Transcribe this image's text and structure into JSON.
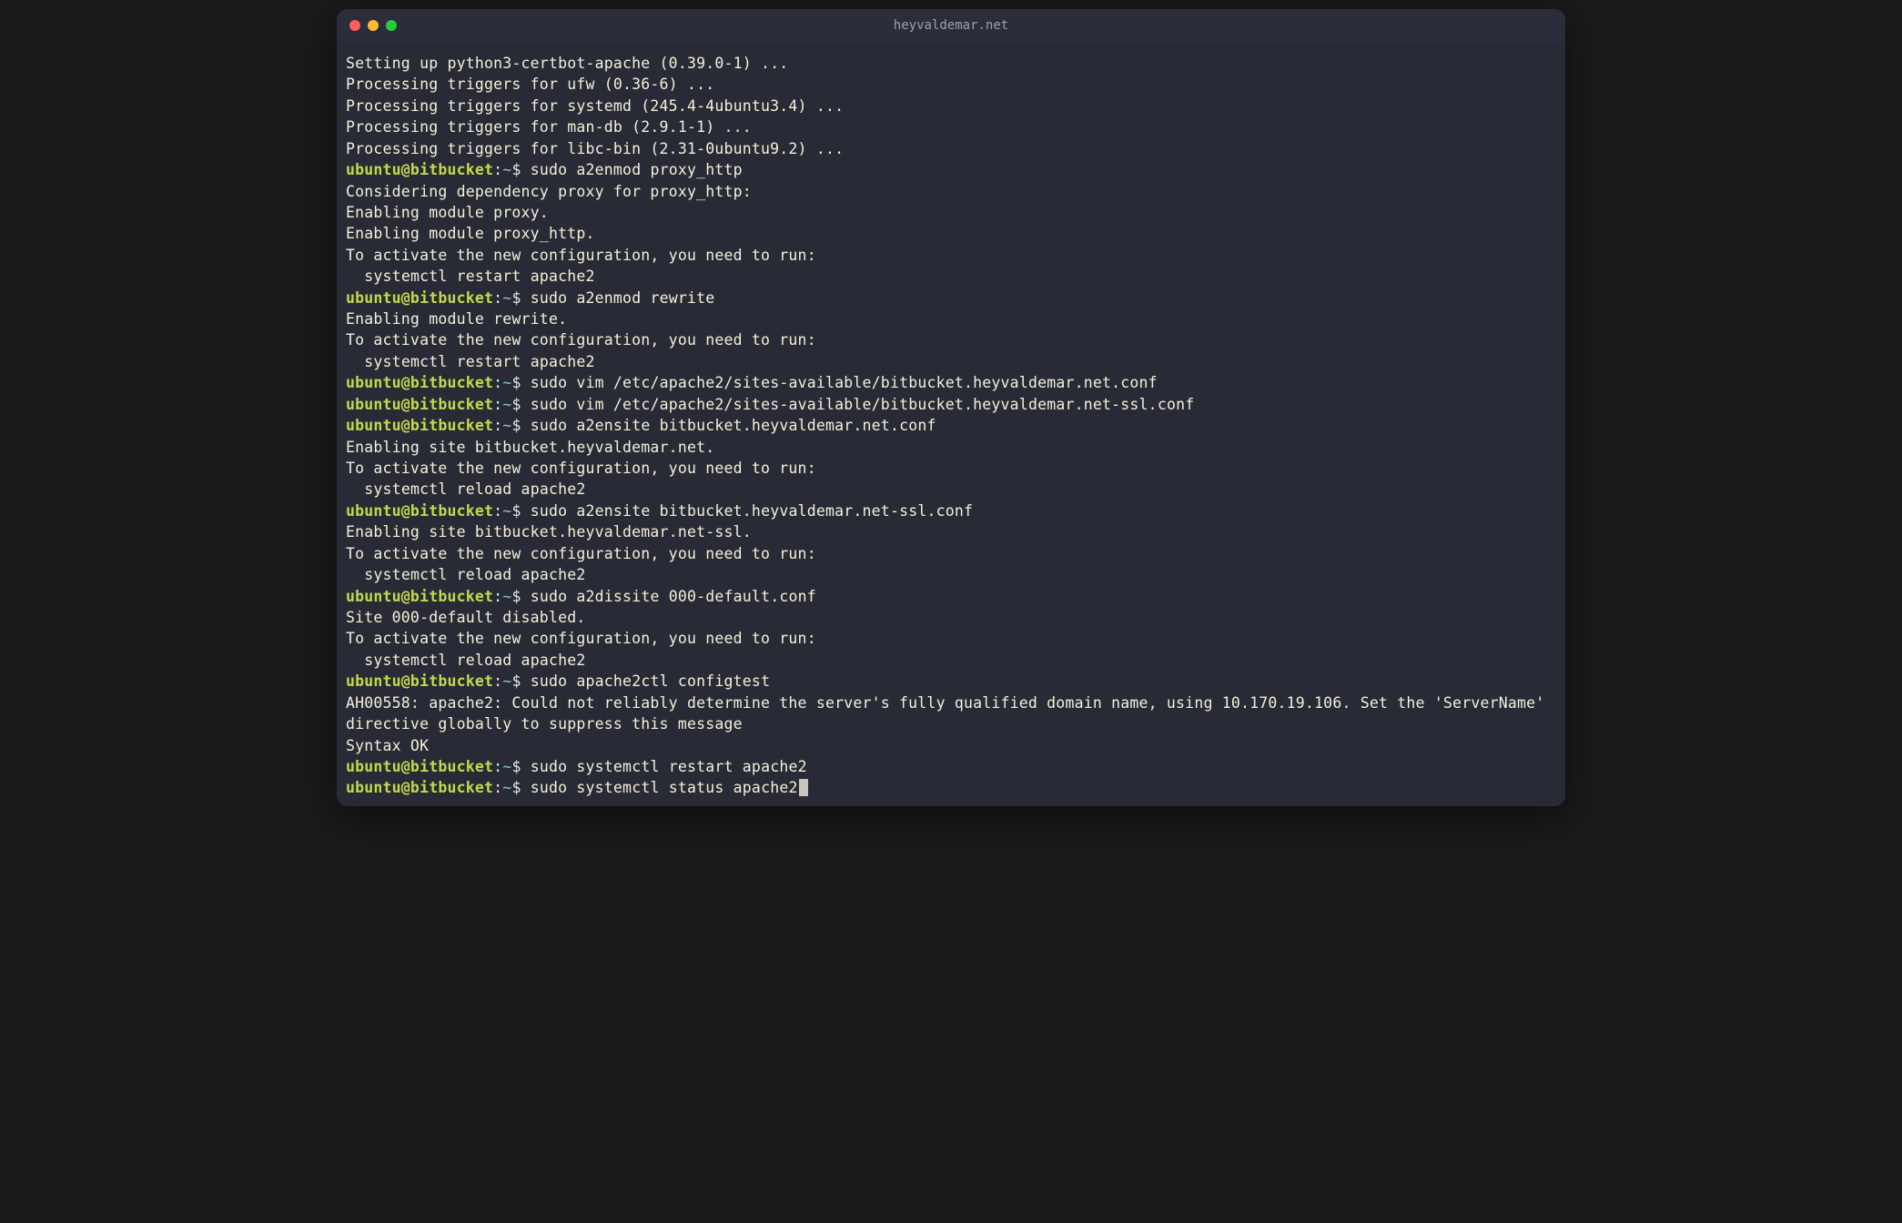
{
  "window": {
    "title": "heyvaldemar.net"
  },
  "colors": {
    "userhost": "#c4d94a",
    "path": "#7ec6e0",
    "text": "#f5f0d8",
    "bg": "#282a36"
  },
  "prompt": {
    "userhost": "ubuntu@bitbucket",
    "colon": ":",
    "path": "~",
    "symbol": "$"
  },
  "lines": [
    {
      "t": "out",
      "text": "Setting up python3-certbot-apache (0.39.0-1) ..."
    },
    {
      "t": "out",
      "text": "Processing triggers for ufw (0.36-6) ..."
    },
    {
      "t": "out",
      "text": "Processing triggers for systemd (245.4-4ubuntu3.4) ..."
    },
    {
      "t": "out",
      "text": "Processing triggers for man-db (2.9.1-1) ..."
    },
    {
      "t": "out",
      "text": "Processing triggers for libc-bin (2.31-0ubuntu9.2) ..."
    },
    {
      "t": "cmd",
      "text": "sudo a2enmod proxy_http"
    },
    {
      "t": "out",
      "text": "Considering dependency proxy for proxy_http:"
    },
    {
      "t": "out",
      "text": "Enabling module proxy."
    },
    {
      "t": "out",
      "text": "Enabling module proxy_http."
    },
    {
      "t": "out",
      "text": "To activate the new configuration, you need to run:"
    },
    {
      "t": "out",
      "text": "  systemctl restart apache2"
    },
    {
      "t": "cmd",
      "text": "sudo a2enmod rewrite"
    },
    {
      "t": "out",
      "text": "Enabling module rewrite."
    },
    {
      "t": "out",
      "text": "To activate the new configuration, you need to run:"
    },
    {
      "t": "out",
      "text": "  systemctl restart apache2"
    },
    {
      "t": "cmd",
      "text": "sudo vim /etc/apache2/sites-available/bitbucket.heyvaldemar.net.conf"
    },
    {
      "t": "cmd",
      "text": "sudo vim /etc/apache2/sites-available/bitbucket.heyvaldemar.net-ssl.conf"
    },
    {
      "t": "cmd",
      "text": "sudo a2ensite bitbucket.heyvaldemar.net.conf"
    },
    {
      "t": "out",
      "text": "Enabling site bitbucket.heyvaldemar.net."
    },
    {
      "t": "out",
      "text": "To activate the new configuration, you need to run:"
    },
    {
      "t": "out",
      "text": "  systemctl reload apache2"
    },
    {
      "t": "cmd",
      "text": "sudo a2ensite bitbucket.heyvaldemar.net-ssl.conf"
    },
    {
      "t": "out",
      "text": "Enabling site bitbucket.heyvaldemar.net-ssl."
    },
    {
      "t": "out",
      "text": "To activate the new configuration, you need to run:"
    },
    {
      "t": "out",
      "text": "  systemctl reload apache2"
    },
    {
      "t": "cmd",
      "text": "sudo a2dissite 000-default.conf"
    },
    {
      "t": "out",
      "text": "Site 000-default disabled."
    },
    {
      "t": "out",
      "text": "To activate the new configuration, you need to run:"
    },
    {
      "t": "out",
      "text": "  systemctl reload apache2"
    },
    {
      "t": "cmd",
      "text": "sudo apache2ctl configtest"
    },
    {
      "t": "out",
      "text": "AH00558: apache2: Could not reliably determine the server's fully qualified domain name, using 10.170.19.106. Set the 'ServerName' directive globally to suppress this message"
    },
    {
      "t": "out",
      "text": "Syntax OK"
    },
    {
      "t": "cmd",
      "text": "sudo systemctl restart apache2"
    },
    {
      "t": "cmd",
      "text": "sudo systemctl status apache2",
      "cursor": true
    }
  ]
}
